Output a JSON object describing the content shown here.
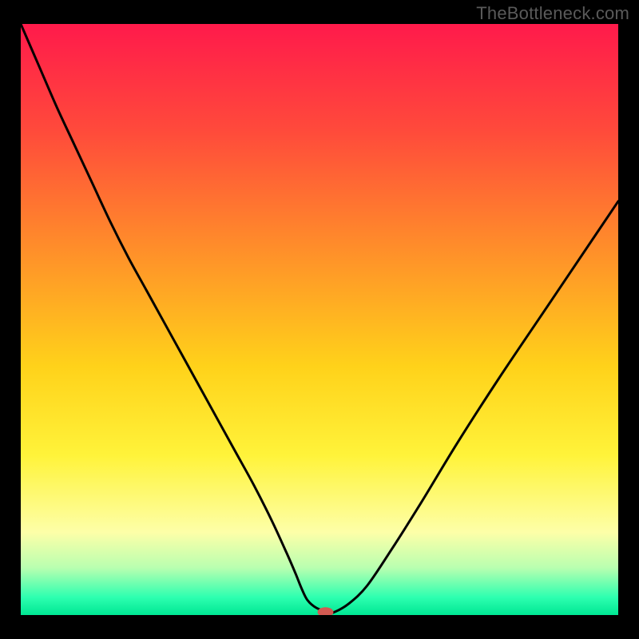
{
  "watermark": "TheBottleneck.com",
  "chart_data": {
    "type": "line",
    "title": "",
    "xlabel": "",
    "ylabel": "",
    "xlim": [
      0,
      100
    ],
    "ylim": [
      0,
      100
    ],
    "background_gradient": {
      "stops": [
        {
          "offset": 0.0,
          "color": "#ff1a4b"
        },
        {
          "offset": 0.18,
          "color": "#ff4a3b"
        },
        {
          "offset": 0.38,
          "color": "#ff8e2a"
        },
        {
          "offset": 0.58,
          "color": "#ffd21a"
        },
        {
          "offset": 0.73,
          "color": "#fff33a"
        },
        {
          "offset": 0.86,
          "color": "#fdffa8"
        },
        {
          "offset": 0.92,
          "color": "#b9ffb0"
        },
        {
          "offset": 0.97,
          "color": "#2dffb0"
        },
        {
          "offset": 1.0,
          "color": "#00e793"
        }
      ]
    },
    "series": [
      {
        "name": "bottleneck-curve",
        "color": "#000000",
        "x": [
          0,
          3,
          6,
          9,
          12,
          15,
          18,
          21,
          24,
          27,
          30,
          33,
          36,
          39,
          42,
          44.5,
          46,
          47,
          48,
          49.5,
          51.5,
          52.5,
          55,
          58,
          62,
          67,
          73,
          80,
          88,
          96,
          100
        ],
        "y": [
          100,
          93,
          86,
          79.5,
          73,
          66.5,
          60.5,
          55,
          49.5,
          44,
          38.5,
          33,
          27.5,
          22,
          16,
          10.5,
          7,
          4.5,
          2.5,
          1.2,
          0.5,
          0.5,
          2,
          5,
          11,
          19,
          29,
          40,
          52,
          64,
          70
        ]
      }
    ],
    "marker": {
      "name": "optimal-point",
      "x": 51,
      "y": 0.5,
      "color": "#d25a52"
    }
  }
}
